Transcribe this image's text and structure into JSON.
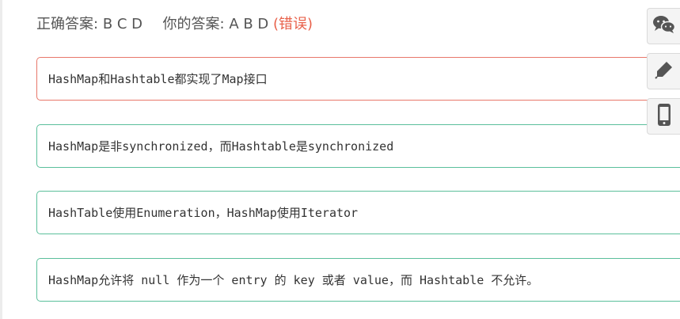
{
  "answer": {
    "correct_label": "正确答案:",
    "correct_value": "B C D",
    "yours_label": "你的答案:",
    "yours_value": "A B D",
    "result": "(错误)"
  },
  "options": [
    {
      "text": "HashMap和Hashtable都实现了Map接口",
      "state": "selected-wrong"
    },
    {
      "text": "HashMap是非synchronized，而Hashtable是synchronized",
      "state": "selected-correct"
    },
    {
      "text": "HashTable使用Enumeration，HashMap使用Iterator",
      "state": "missed-correct"
    },
    {
      "text": "HashMap允许将 null 作为一个 entry 的 key 或者 value，而 Hashtable 不允许。",
      "state": "selected-correct"
    }
  ],
  "side_tools": [
    {
      "icon": "wechat-icon"
    },
    {
      "icon": "edit-icon"
    },
    {
      "icon": "mobile-icon"
    }
  ],
  "colors": {
    "correct_border": "#5bbf9b",
    "wrong_border": "#e8776a",
    "error_text": "#e8614a",
    "icon_gray": "#555555"
  }
}
